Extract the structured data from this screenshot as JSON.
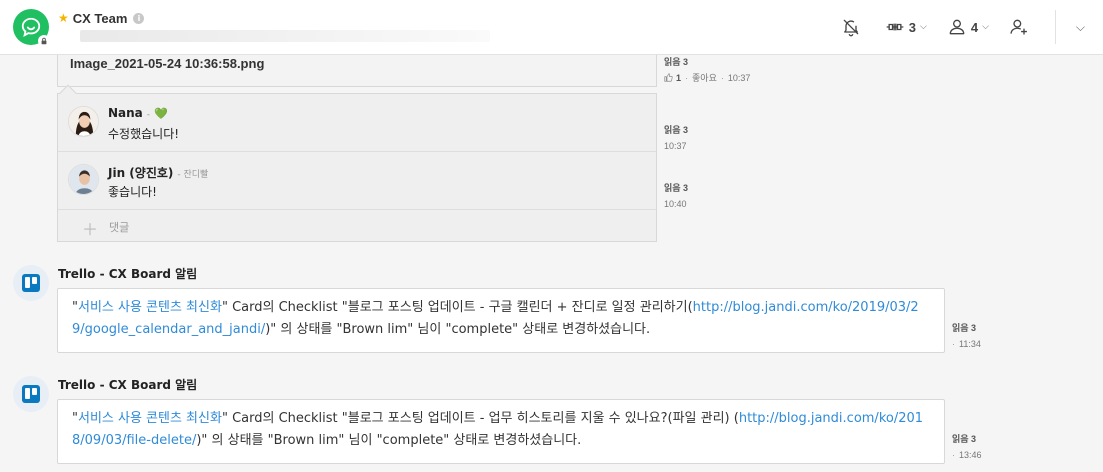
{
  "header": {
    "team_name": "CX Team",
    "info_glyph": "i",
    "notifications_count": "3",
    "members_count": "4"
  },
  "file_message": {
    "file_name": "Image_2021-05-24 10:36:58.png",
    "read": "읽음 3",
    "like_count": "1",
    "like_label": "좋아요",
    "time": "10:37"
  },
  "comments": [
    {
      "name": "Nana",
      "sub": "-",
      "heart": "💚",
      "text": "수정했습니다!",
      "read": "읽음 3",
      "time": "10:37"
    },
    {
      "name": "Jin (양진호)",
      "sub": "- 잔디빨",
      "text": "좋습니다!",
      "read": "읽음 3",
      "time": "10:40"
    }
  ],
  "comment_placeholder": "댓글",
  "messages": [
    {
      "sender": "Trello - CX Board 알림",
      "link1": "서비스 사용 콘텐츠 최신화",
      "part1": "\" Card의 Checklist \"블로그 포스팅 업데이트 - 구글 캘린더 + 잔디로 일정 관리하기(",
      "link2": "http://blog.jandi.com/ko/2019/03/29/google_calendar_and_jandi/",
      "part2": ")\" 의 상태를 \"Brown lim\" 님이 \"complete\" 상태로 변경하셨습니다.",
      "read": "읽음 3",
      "time": "11:34"
    },
    {
      "sender": "Trello - CX Board 알림",
      "link1": "서비스 사용 콘텐츠 최신화",
      "part1": "\" Card의 Checklist \"블로그 포스팅 업데이트 - 업무 히스토리를 지울 수 있나요?(파일 관리) (",
      "link2": "http://blog.jandi.com/ko/2018/09/03/file-delete/",
      "part2": ")\" 의 상태를 \"Brown lim\" 님이 \"complete\" 상태로 변경하셨습니다.",
      "read": "읽음 3",
      "time": "13:46"
    }
  ],
  "colors": {
    "brand_green": "#1fbf62",
    "link_blue": "#2f8bd8",
    "star": "#f5b400",
    "trello_blue": "#0a79bf"
  },
  "icons": [
    "chat-icon",
    "lock-icon",
    "star-icon",
    "info-icon",
    "bell-off-icon",
    "connect-icon",
    "user-icon",
    "add-user-icon",
    "chevron-down-icon",
    "thumbs-up-icon",
    "plus-icon",
    "trello-icon"
  ]
}
